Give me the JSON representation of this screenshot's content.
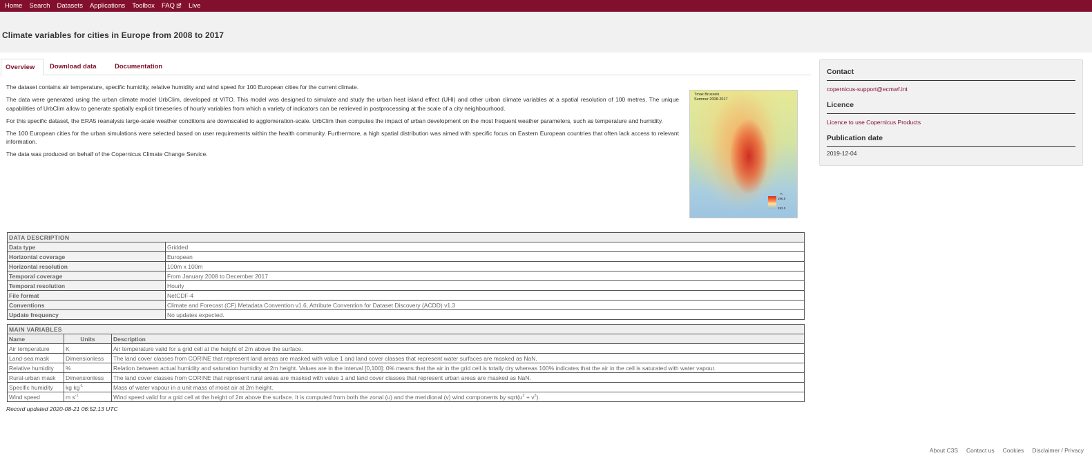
{
  "nav": {
    "items": [
      "Home",
      "Search",
      "Datasets",
      "Applications",
      "Toolbox",
      "FAQ",
      "Live"
    ]
  },
  "page": {
    "title": "Climate variables for cities in Europe from 2008 to 2017"
  },
  "tabs": {
    "overview": "Overview",
    "download": "Download data",
    "documentation": "Documentation"
  },
  "overview": {
    "paragraphs": [
      "The dataset contains air temperature, specific humidity, relative humidity and wind speed for 100 European cities for the current climate.",
      "The data were generated using the urban climate model UrbClim, developed at VITO. This model was designed to simulate and study the urban heat island effect (UHI) and other urban climate variables at a spatial resolution of 100 metres. The unique capabilities of UrbClim allow to generate spatially explicit timeseries of hourly variables from which a variety of indicators can be retrieved in postprocessing at the scale of a city neighbourhood.",
      "For this specific dataset, the ERA5 reanalysis large-scale weather conditions are downscaled to agglomeration-scale. UrbClim then computes the impact of urban development on the most frequent weather parameters, such as temperature and humidity.",
      "The 100 European cities for the urban simulations were selected based on user requirements within the health community. Furthermore, a high spatial distribution was aimed with specific focus on Eastern European countries that often lack access to relevant information.",
      "The data was produced on behalf of the Copernicus Climate Change Service."
    ]
  },
  "thumbnail": {
    "title_line1": "Tmax Brussels",
    "title_line2": "Summer 2008-2017",
    "legend_unit": "K",
    "legend_high": "296.5",
    "legend_low": "293.0"
  },
  "sidebar": {
    "contact_heading": "Contact",
    "contact_email": "copernicus-support@ecmwf.int",
    "licence_heading": "Licence",
    "licence_link": "Licence to use Copernicus Products",
    "publication_heading": "Publication date",
    "publication_date": "2019-12-04"
  },
  "data_description": {
    "heading": "DATA DESCRIPTION",
    "rows": [
      {
        "key": "Data type",
        "value": "Gridded"
      },
      {
        "key": "Horizontal coverage",
        "value": "European"
      },
      {
        "key": "Horizontal resolution",
        "value": "100m x 100m"
      },
      {
        "key": "Temporal coverage",
        "value": "From January 2008 to December 2017"
      },
      {
        "key": "Temporal resolution",
        "value": "Hourly"
      },
      {
        "key": "File format",
        "value": "NetCDF-4"
      },
      {
        "key": "Conventions",
        "value": "Climate and Forecast (CF) Metadata Convention v1.6, Attribute Convention for Dataset Discovery (ACDD) v1.3"
      },
      {
        "key": "Update frequency",
        "value": "No updates expected."
      }
    ]
  },
  "main_variables": {
    "heading": "MAIN VARIABLES",
    "columns": [
      "Name",
      "Units",
      "Description"
    ],
    "rows": [
      {
        "name": "Air temperature",
        "units": "K",
        "description": "Air temperature valid for a grid cell at the height of 2m above the surface."
      },
      {
        "name": "Land-sea mask",
        "units": "Dimensionless",
        "description": "The land cover classes from CORINE that represent land areas are masked with value 1 and land cover classes that represent water surfaces are masked as NaN."
      },
      {
        "name": "Relative humidity",
        "units": "%",
        "description": "Relation between actual humidity and saturation humidity at 2m height. Values are in the interval [0,100]: 0% means that the air in the grid cell is totally dry whereas 100% indicates that the air in the cell is saturated with water vapour."
      },
      {
        "name": "Rural-urban mask",
        "units": "Dimensionless",
        "description": "The land cover classes from CORINE that represent rural areas are masked with value 1 and land cover classes that represent urban areas are masked as NaN."
      },
      {
        "name": "Specific humidity",
        "units": "kg kg",
        "units_sup": "-1",
        "description": "Mass of water vapour in a unit mass of moist air at 2m height."
      },
      {
        "name": "Wind speed",
        "units": "m s",
        "units_sup": "-1",
        "description_pre": "Wind speed valid for a grid cell at the height of 2m above the surface. It is computed from both the zonal (u) and the meridional (v) wind components by sqrt(u",
        "description_mid": " + v",
        "description_post": ")."
      }
    ]
  },
  "record": "Record updated 2020-08-21 06:52:13 UTC",
  "footer": [
    "About C3S",
    "Contact us",
    "Cookies",
    "Disclaimer / Privacy"
  ]
}
